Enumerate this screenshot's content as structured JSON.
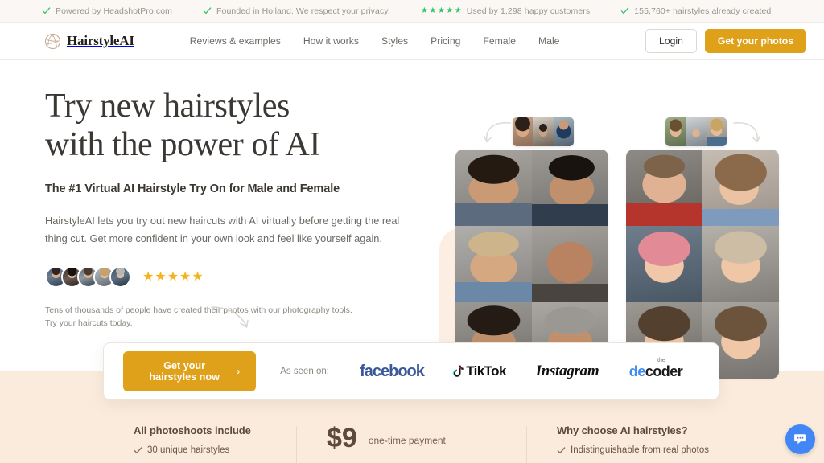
{
  "topbar": {
    "items": [
      {
        "icon": "check-icon",
        "text": "Powered by HeadshotPro.com"
      },
      {
        "icon": "check-icon",
        "text": "Founded in Holland. We respect your privacy."
      },
      {
        "icon": "stars-icon",
        "text": "Used by 1,298 happy customers",
        "stars": 5
      },
      {
        "icon": "check-icon",
        "text": "155,760+ hairstyles already created"
      }
    ],
    "accent_color": "#2fc46a"
  },
  "header": {
    "brand_name": "HairstyleAI",
    "brand_icon": "hairstyle-logo-icon",
    "nav": [
      {
        "label": "Reviews & examples"
      },
      {
        "label": "How it works"
      },
      {
        "label": "Styles"
      },
      {
        "label": "Pricing"
      },
      {
        "label": "Female"
      },
      {
        "label": "Male"
      }
    ],
    "login_label": "Login",
    "cta_label": "Get your photos",
    "cta_color": "#e0a11a"
  },
  "hero": {
    "title_line1": "Try new hairstyles",
    "title_line2": "with the power of AI",
    "subtitle": "The #1 Virtual AI Hairstyle Try On for Male and Female",
    "body": "HairstyleAI lets you try out new haircuts with AI virtually before getting the real thing cut. Get more confident in your own look and feel like yourself again.",
    "rating_stars": 5,
    "rating_color": "#f5b41d",
    "avatar_count": 5,
    "note": "Tens of thousands of people have created their photos with our photography tools. Try your haircuts today."
  },
  "showcase": {
    "male_grid_label": "male-hairstyle-results-grid",
    "female_grid_label": "female-hairstyle-results-grid",
    "male_thumbs_label": "male-source-photos-strip",
    "female_thumbs_label": "female-source-photos-strip"
  },
  "cta_card": {
    "button_label": "Get your hairstyles now",
    "button_chevron": "chevron-right-icon",
    "as_seen_label": "As seen on:",
    "logos": [
      {
        "name": "facebook-logo",
        "text": "facebook"
      },
      {
        "name": "tiktok-logo",
        "text": "TikTok"
      },
      {
        "name": "instagram-logo",
        "text": "Instagram"
      },
      {
        "name": "decoder-logo",
        "small": "the",
        "text_a": "de",
        "text_b": "coder"
      }
    ]
  },
  "bottom": {
    "col1_title": "All photoshoots include",
    "col1_items": [
      {
        "text": "30 unique hairstyles"
      }
    ],
    "price": "$9",
    "price_note": "one-time payment",
    "col3_title": "Why choose AI hairstyles?",
    "col3_items": [
      {
        "text": "Indistinguishable from real photos"
      }
    ]
  },
  "chat": {
    "icon": "chat-bubble-icon",
    "color": "#4285f4"
  }
}
